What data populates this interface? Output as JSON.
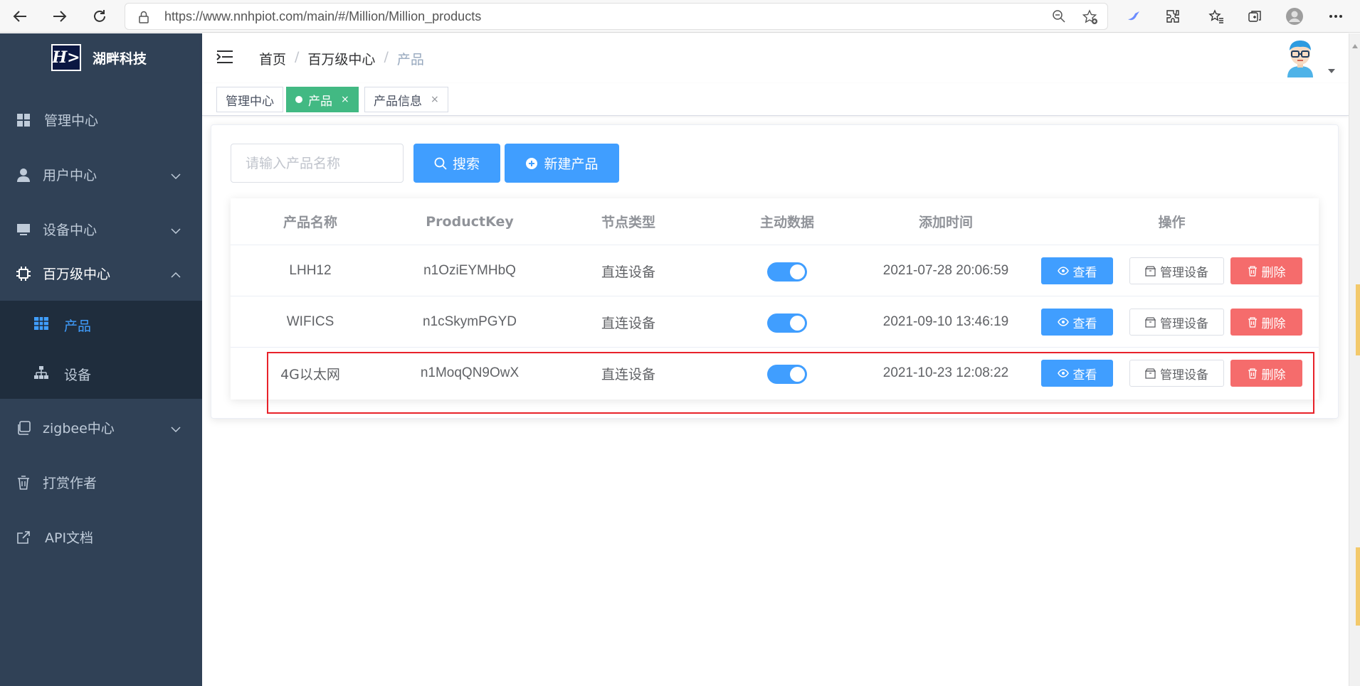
{
  "browser": {
    "url": "https://www.nnhpiot.com/main/#/Million/Million_products"
  },
  "sidebar": {
    "logo_mark": "H>",
    "brand": "湖畔科技",
    "items": [
      {
        "label": "管理中心",
        "icon": "dashboard-icon"
      },
      {
        "label": "用户中心",
        "icon": "user-icon"
      },
      {
        "label": "设备中心",
        "icon": "monitor-icon"
      },
      {
        "label": "百万级中心",
        "icon": "chip-icon"
      },
      {
        "label": "zigbee中心",
        "icon": "copy-icon"
      },
      {
        "label": "打赏作者",
        "icon": "cup-icon"
      },
      {
        "label": "API文档",
        "icon": "external-link-icon"
      }
    ],
    "sub_items": [
      {
        "label": "产品",
        "icon": "table-icon"
      },
      {
        "label": "设备",
        "icon": "tree-icon"
      }
    ]
  },
  "header": {
    "breadcrumb": [
      "首页",
      "百万级中心",
      "产品"
    ]
  },
  "tags": [
    {
      "label": "管理中心"
    },
    {
      "label": "产品"
    },
    {
      "label": "产品信息"
    }
  ],
  "toolbar": {
    "search_placeholder": "请输入产品名称",
    "search_label": "搜索",
    "new_label": "新建产品"
  },
  "table": {
    "columns": [
      "产品名称",
      "ProductKey",
      "节点类型",
      "主动数据",
      "添加时间",
      "操作"
    ],
    "rows": [
      {
        "name": "LHH12",
        "key": "n1OziEYMHbQ",
        "node_type": "直连设备",
        "active": true,
        "time": "2021-07-28 20:06:59"
      },
      {
        "name": "WIFICS",
        "key": "n1cSkymPGYD",
        "node_type": "直连设备",
        "active": true,
        "time": "2021-09-10 13:46:19"
      },
      {
        "name": "4G以太网",
        "key": "n1MoqQN9OwX",
        "node_type": "直连设备",
        "active": true,
        "time": "2021-10-23 12:08:22"
      }
    ],
    "actions": {
      "view": "查看",
      "manage": "管理设备",
      "delete": "删除"
    }
  },
  "colors": {
    "sidebar_bg": "#304156",
    "submenu_bg": "#1f2d3d",
    "primary": "#409eff",
    "danger": "#f56c6c",
    "tag_active": "#42b983",
    "highlight_box": "#e8222a"
  }
}
